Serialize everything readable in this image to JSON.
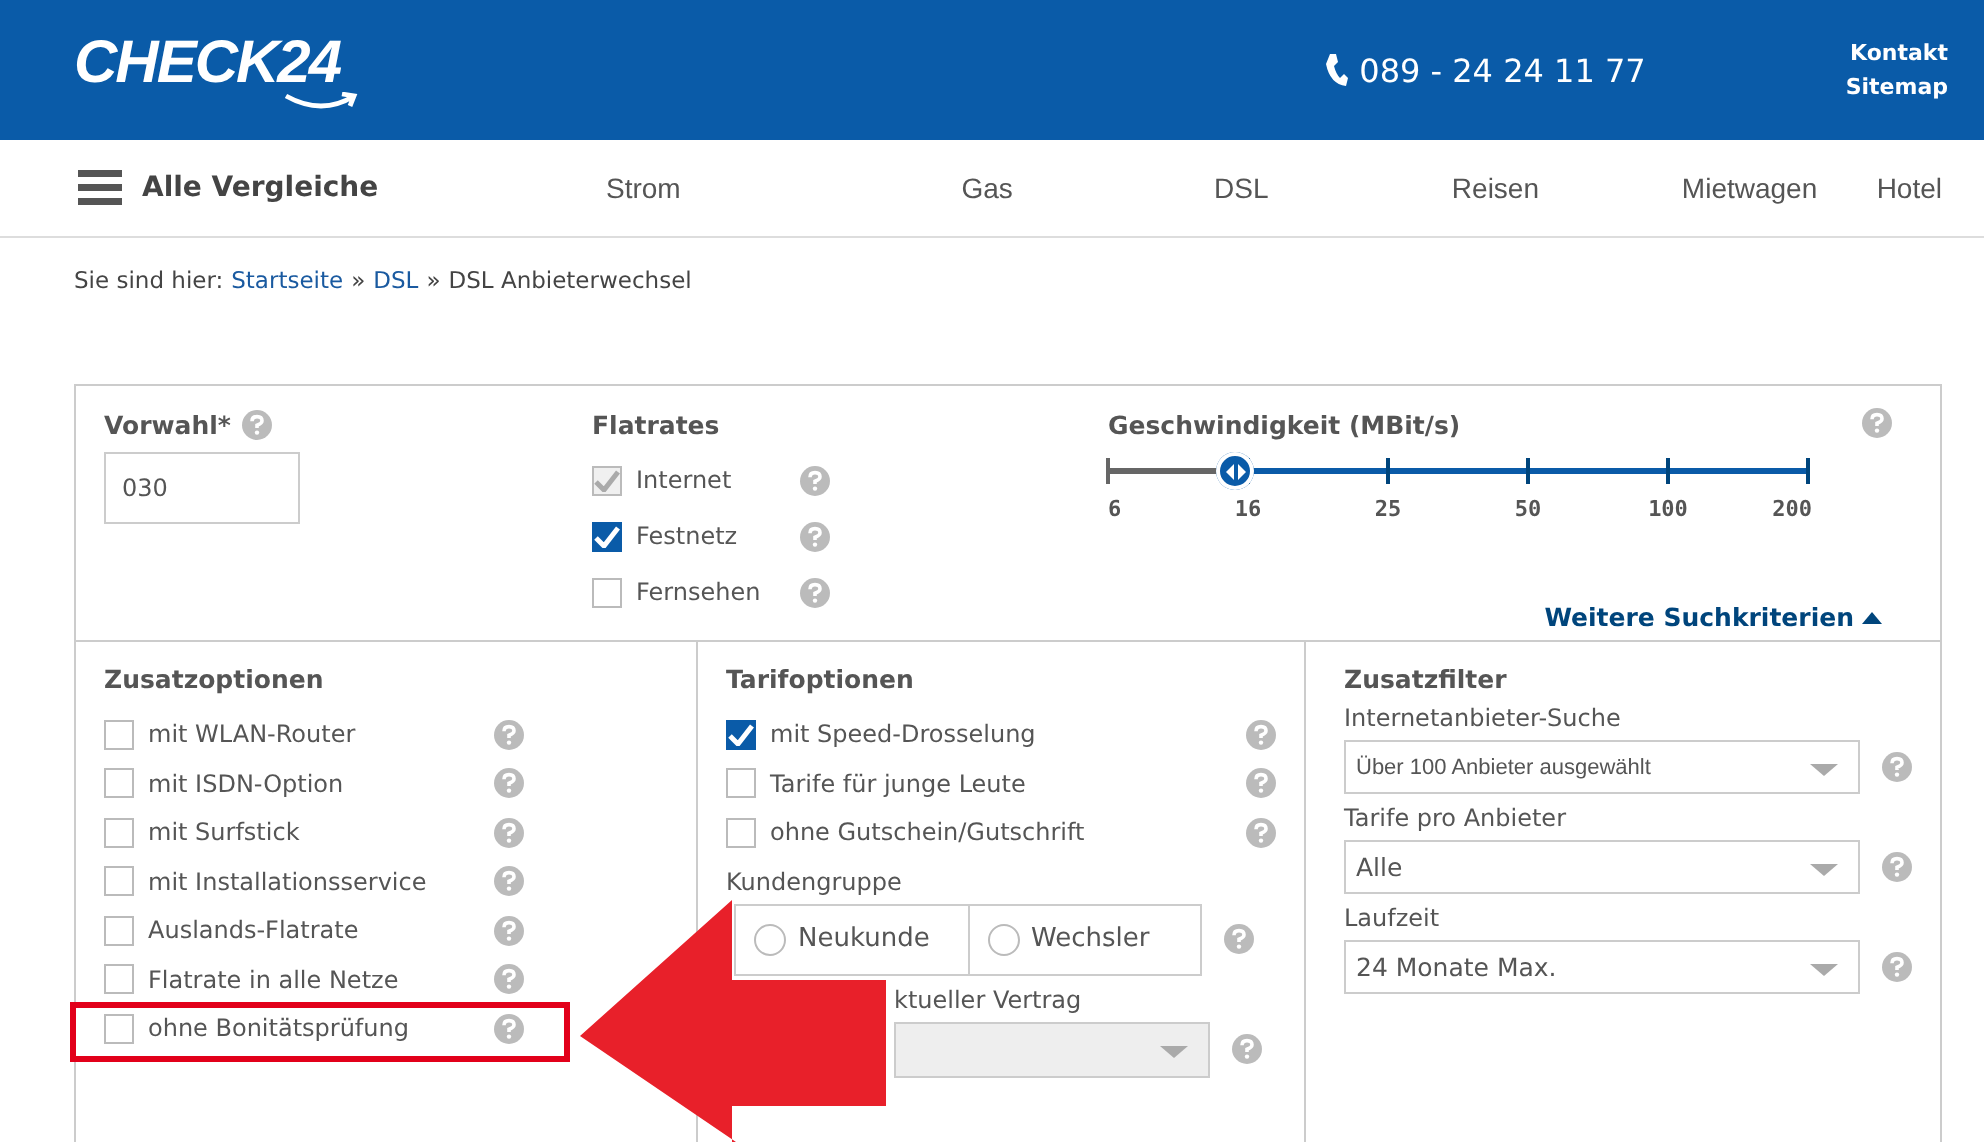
{
  "header": {
    "logo": "CHECK24",
    "phone": "089 - 24 24 11 77",
    "links": [
      "Kontakt",
      "Sitemap"
    ]
  },
  "nav": {
    "menu_label": "Alle Vergleiche",
    "items": [
      "Strom",
      "Gas",
      "DSL",
      "Reisen",
      "Mietwagen",
      "Hotel"
    ]
  },
  "breadcrumb": [
    {
      "kind": "text",
      "text": "Sie sind hier:"
    },
    {
      "kind": "link",
      "text": "Startseite"
    },
    {
      "kind": "text",
      "text": "»"
    },
    {
      "kind": "link",
      "text": "DSL"
    },
    {
      "kind": "text",
      "text": "»"
    },
    {
      "kind": "text",
      "text": "DSL Anbieterwechsel"
    }
  ],
  "vorwahl": {
    "label": "Vorwahl*",
    "value": "030"
  },
  "flatrates": {
    "title": "Flatrates",
    "items": [
      {
        "label": "Internet",
        "checked": true,
        "disabled": true
      },
      {
        "label": "Festnetz",
        "checked": true,
        "disabled": false
      },
      {
        "label": "Fernsehen",
        "checked": false,
        "disabled": false
      }
    ]
  },
  "speed": {
    "title": "Geschwindigkeit (MBit/s)",
    "level": 0.18,
    "ticks": [
      "6",
      "16",
      "25",
      "50",
      "100",
      "200"
    ]
  },
  "more_link": "Weitere Suchkriterien",
  "zusatzoptionen": {
    "title": "Zusatzoptionen",
    "items": [
      {
        "label": "mit WLAN-Router",
        "checked": false,
        "highlighted": false
      },
      {
        "label": "mit ISDN-Option",
        "checked": false,
        "highlighted": false
      },
      {
        "label": "mit Surfstick",
        "checked": false,
        "highlighted": false
      },
      {
        "label": "mit Installationsservice",
        "checked": false,
        "highlighted": false
      },
      {
        "label": "Auslands-Flatrate",
        "checked": false,
        "highlighted": false
      },
      {
        "label": "Flatrate in alle Netze",
        "checked": false,
        "highlighted": false
      },
      {
        "label": "ohne Bonitätsprüfung",
        "checked": false,
        "highlighted": true
      }
    ]
  },
  "tarifoptionen": {
    "title": "Tarifoptionen",
    "items": [
      {
        "label": "mit Speed-Drosselung",
        "checked": true
      },
      {
        "label": "Tarife für junge Leute",
        "checked": false
      },
      {
        "label": "ohne Gutschein/Gutschrift",
        "checked": false
      }
    ],
    "kundengruppe": {
      "label": "Kundengruppe",
      "options": [
        {
          "label": "Neukunde",
          "selected": false
        },
        {
          "label": "Wechsler",
          "selected": false
        }
      ]
    },
    "vertrag": {
      "label": "ktueller Vertrag",
      "disabled": true
    }
  },
  "zusatzfilter": {
    "title": "Zusatzfilter",
    "fields": [
      {
        "label": "Internetanbieter-Suche",
        "value": "Über 100 Anbieter ausgewählt"
      },
      {
        "label": "Tarife pro Anbieter",
        "value": "Alle"
      },
      {
        "label": "Laufzeit",
        "value": "24 Monate Max."
      }
    ]
  },
  "annotation_arrow": true
}
